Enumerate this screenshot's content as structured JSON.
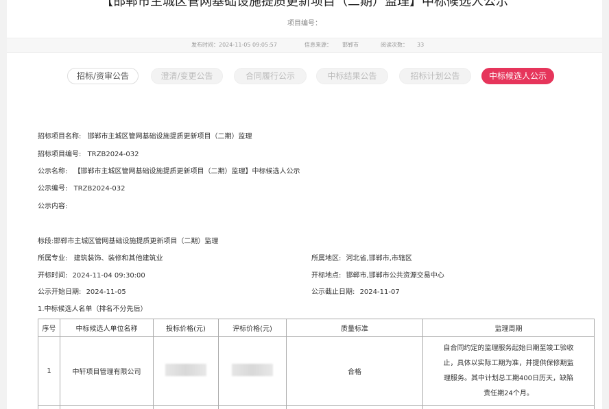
{
  "page": {
    "title": "【邯郸市主城区管网基础设施提质更新项目（二期）监理】中标候选人公示",
    "project_no_label": "项目编号："
  },
  "meta": {
    "publish_time": "发布时间：2024-11-05 09:05:57",
    "source_label": "信息来源：",
    "source_value": "邯郸市",
    "views_label": "阅读次数：",
    "views_value": "33"
  },
  "tabs": [
    {
      "label": "招标/资审公告"
    },
    {
      "label": "澄清/变更公告"
    },
    {
      "label": "合同履行公示"
    },
    {
      "label": "中标结果公告"
    },
    {
      "label": "招标计划公告"
    },
    {
      "label": "中标候选人公示"
    }
  ],
  "info": {
    "project_name_label": "招标项目名称:",
    "project_name_value": "邯郸市主城区管网基础设施提质更新项目（二期）监理",
    "project_code_label": "招标项目编号:",
    "project_code_value": "TRZB2024-032",
    "notice_name_label": "公示名称:",
    "notice_name_value": "【邯郸市主城区管网基础设施提质更新项目（二期）监理】中标候选人公示",
    "notice_code_label": "公示编号:",
    "notice_code_value": "TRZB2024-032",
    "notice_content_label": "公示内容:"
  },
  "section": {
    "lot": "标段:邯郸市主城区管网基础设施提质更新项目（二期）监理",
    "specialty_label": "所属专业:",
    "specialty_value": "建筑装饰、装修和其他建筑业",
    "region_label": "所属地区:",
    "region_value": "河北省,邯郸市,市辖区",
    "open_time_label": "开标时间:",
    "open_time_value": "2024-11-04 09:30:00",
    "open_place_label": "开标地点:",
    "open_place_value": "邯郸市,邯郸市公共资源交易中心",
    "start_date_label": "公示开始日期:",
    "start_date_value": "2024-11-05",
    "end_date_label": "公示截止日期:",
    "end_date_value": "2024-11-07",
    "list_heading": "1.中标候选人名单（排名不分先后）"
  },
  "table": {
    "headers": [
      "序号",
      "中标候选人单位名称",
      "投标价格(元)",
      "评标价格(元)",
      "质量标准",
      "监理周期"
    ],
    "rows": [
      {
        "no": "1",
        "name": "中轩项目管理有限公司",
        "quality": "合格",
        "period_lines": [
          "自合同约定的监理服务起始日期至竣工验收",
          "止，具体以实际工期为准，并提供保修期监",
          "理服务。其中计划总工期400日历天，缺陷",
          "责任期24个月。"
        ]
      }
    ]
  }
}
